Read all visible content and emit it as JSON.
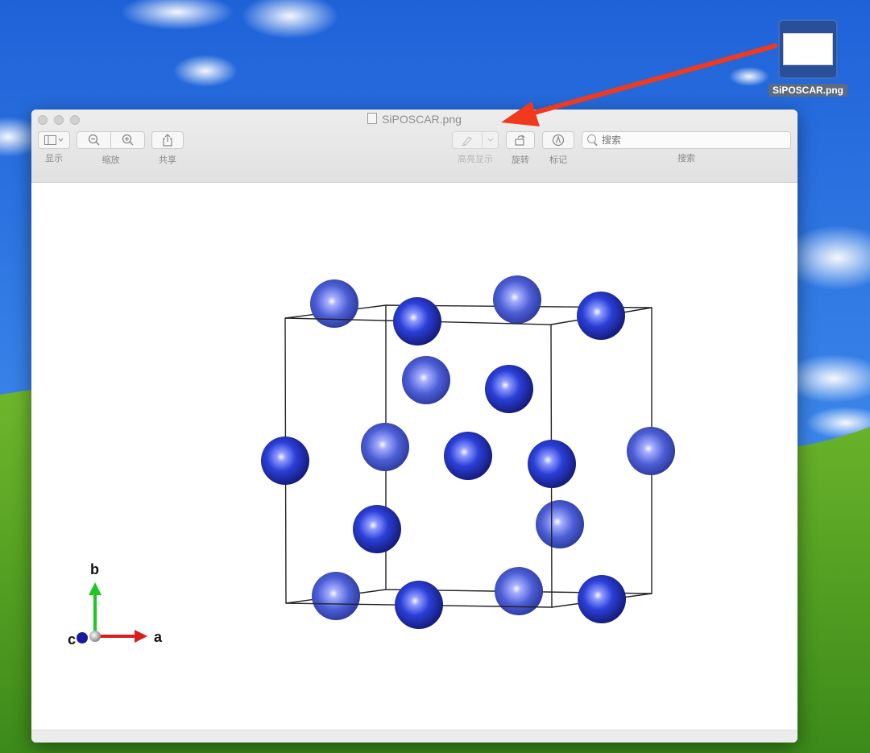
{
  "window": {
    "title": "SiPOSCAR.png"
  },
  "desktop_icon": {
    "label": "SiPOSCAR.png"
  },
  "toolbar": {
    "view_label": "显示",
    "zoom_label": "缩放",
    "share_label": "共享",
    "highlight_label": "高亮显示",
    "rotate_label": "旋转",
    "markup_label": "标记",
    "search_label": "搜索",
    "search_placeholder": "搜索"
  },
  "axes": {
    "a": "a",
    "b": "b",
    "c": "c"
  },
  "colors": {
    "atom": "#2a3fd0",
    "axis_a": "#d81e1e",
    "axis_b": "#1ec81e",
    "axis_c": "#1a1aa0",
    "annotation_arrow": "#f03a1e"
  }
}
